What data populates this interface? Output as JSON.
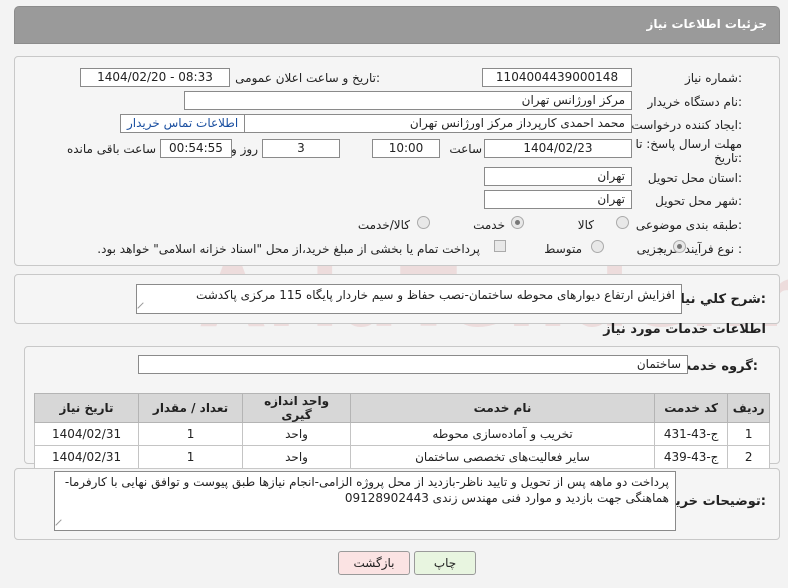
{
  "header": {
    "title": "جزئیات اطلاعات نیاز"
  },
  "fields": {
    "need_number_label": "شماره نیاز:",
    "need_number": "1104004439000148",
    "announce_label": "تاریخ و ساعت اعلان عمومی:",
    "announce_value": "1404/02/20 - 08:33",
    "buyer_org_label": "نام دستگاه خریدار:",
    "buyer_org": "مرکز اورژانس تهران",
    "creator_label": "ایجاد کننده درخواست:",
    "creator": "محمد احمدی کارپرداز مرکز اورژانس تهران",
    "contact_link": "اطلاعات تماس خریدار",
    "deadline_label_1": "مهلت ارسال پاسخ: تا",
    "deadline_label_2": "تاریخ:",
    "deadline_date": "1404/02/23",
    "time_label": "ساعت",
    "deadline_time": "10:00",
    "days_value": "3",
    "days_label": "روز و",
    "remaining_time": "00:54:55",
    "remaining_label": "ساعت باقی مانده",
    "province_label": "استان محل تحویل:",
    "province": "تهران",
    "city_label": "شهر محل تحویل:",
    "city": "تهران",
    "category_label": "طبقه بندی موضوعی:",
    "category_options": [
      "کالا",
      "خدمت",
      "کالا/خدمت"
    ],
    "purchase_type_label": "نوع فرآیند خرید :",
    "purchase_options": [
      "جزیی",
      "متوسط"
    ],
    "purchase_note": "پرداخت تمام یا بخشی از مبلغ خرید،از محل \"اسناد خزانه اسلامی\" خواهد بود."
  },
  "summary": {
    "label": "شرح کلي نياز:",
    "text": "افزایش ارتفاع دیوارهای محوطه ساختمان-نصب حفاظ و سیم خاردار پایگاه 115 مرکزی پاکدشت"
  },
  "services": {
    "section_title": "اطلاعات خدمات مورد نیاز",
    "group_label": "گروه خدمت:",
    "group_value": "ساختمان",
    "columns": [
      "ردیف",
      "کد خدمت",
      "نام خدمت",
      "واحد اندازه گیری",
      "تعداد / مقدار",
      "تاریخ نیاز"
    ],
    "rows": [
      [
        "1",
        "ج-43-431",
        "تخریب و آماده‌سازی محوطه",
        "واحد",
        "1",
        "1404/02/31"
      ],
      [
        "2",
        "ج-43-439",
        "سایر فعالیت‌های تخصصی ساختمان",
        "واحد",
        "1",
        "1404/02/31"
      ]
    ]
  },
  "buyer_notes": {
    "label": "توضیحات خریدار:",
    "line1": "پرداخت دو ماهه پس از تحویل و تایید ناظر-بازدید از محل پروژه الزامی-انجام نیازها طبق پیوست و توافق نهایی با کارفرما-",
    "line2": "هماهنگی جهت بازدید و موارد فنی مهندس زندی 09128902443"
  },
  "buttons": {
    "print": "چاپ",
    "back": "بازگشت"
  },
  "watermark": "AriaTender.neT"
}
